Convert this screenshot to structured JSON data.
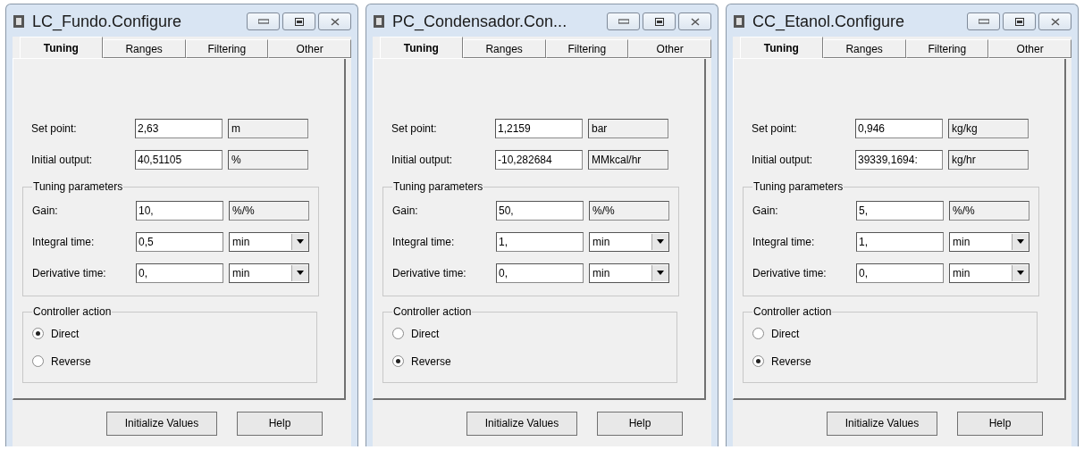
{
  "windows": [
    {
      "title": "LC_Fundo.Configure",
      "tabs": [
        {
          "label": "Tuning",
          "selected": true
        },
        {
          "label": "Ranges",
          "selected": false
        },
        {
          "label": "Filtering",
          "selected": false
        },
        {
          "label": "Other",
          "selected": false
        }
      ],
      "fields": [
        {
          "label": "Set point:",
          "value": "2,63",
          "unit": "m"
        },
        {
          "label": "Initial output:",
          "value": "40,51105",
          "unit": "%"
        }
      ],
      "tuning_group": {
        "title": "Tuning parameters",
        "params": [
          {
            "label": "Gain:",
            "value": "10,",
            "unit": "%/%",
            "kind": "readonly"
          },
          {
            "label": "Integral time:",
            "value": "0,5",
            "unit": "min",
            "kind": "dropdown"
          },
          {
            "label": "Derivative time:",
            "value": "0,",
            "unit": "min",
            "kind": "dropdown"
          }
        ]
      },
      "action_group": {
        "title": "Controller action",
        "options": [
          {
            "label": "Direct",
            "selected": true
          },
          {
            "label": "Reverse",
            "selected": false
          }
        ]
      },
      "buttons": [
        "Initialize Values",
        "Help"
      ]
    },
    {
      "title": "PC_Condensador.Con...",
      "tabs": [
        {
          "label": "Tuning",
          "selected": true
        },
        {
          "label": "Ranges",
          "selected": false
        },
        {
          "label": "Filtering",
          "selected": false
        },
        {
          "label": "Other",
          "selected": false
        }
      ],
      "fields": [
        {
          "label": "Set point:",
          "value": "1,2159",
          "unit": "bar"
        },
        {
          "label": "Initial output:",
          "value": "-10,282684",
          "unit": "MMkcal/hr"
        }
      ],
      "tuning_group": {
        "title": "Tuning parameters",
        "params": [
          {
            "label": "Gain:",
            "value": "50,",
            "unit": "%/%",
            "kind": "readonly"
          },
          {
            "label": "Integral time:",
            "value": "1,",
            "unit": "min",
            "kind": "dropdown"
          },
          {
            "label": "Derivative time:",
            "value": "0,",
            "unit": "min",
            "kind": "dropdown"
          }
        ]
      },
      "action_group": {
        "title": "Controller action",
        "options": [
          {
            "label": "Direct",
            "selected": false
          },
          {
            "label": "Reverse",
            "selected": true
          }
        ]
      },
      "buttons": [
        "Initialize Values",
        "Help"
      ]
    },
    {
      "title": "CC_Etanol.Configure",
      "tabs": [
        {
          "label": "Tuning",
          "selected": true
        },
        {
          "label": "Ranges",
          "selected": false
        },
        {
          "label": "Filtering",
          "selected": false
        },
        {
          "label": "Other",
          "selected": false
        }
      ],
      "fields": [
        {
          "label": "Set point:",
          "value": "0,946",
          "unit": "kg/kg"
        },
        {
          "label": "Initial output:",
          "value": "39339,1694:",
          "unit": "kg/hr"
        }
      ],
      "tuning_group": {
        "title": "Tuning parameters",
        "params": [
          {
            "label": "Gain:",
            "value": "5,",
            "unit": "%/%",
            "kind": "readonly"
          },
          {
            "label": "Integral time:",
            "value": "1,",
            "unit": "min",
            "kind": "dropdown"
          },
          {
            "label": "Derivative time:",
            "value": "0,",
            "unit": "min",
            "kind": "dropdown"
          }
        ]
      },
      "action_group": {
        "title": "Controller action",
        "options": [
          {
            "label": "Direct",
            "selected": false
          },
          {
            "label": "Reverse",
            "selected": true
          }
        ]
      },
      "buttons": [
        "Initialize Values",
        "Help"
      ]
    }
  ]
}
